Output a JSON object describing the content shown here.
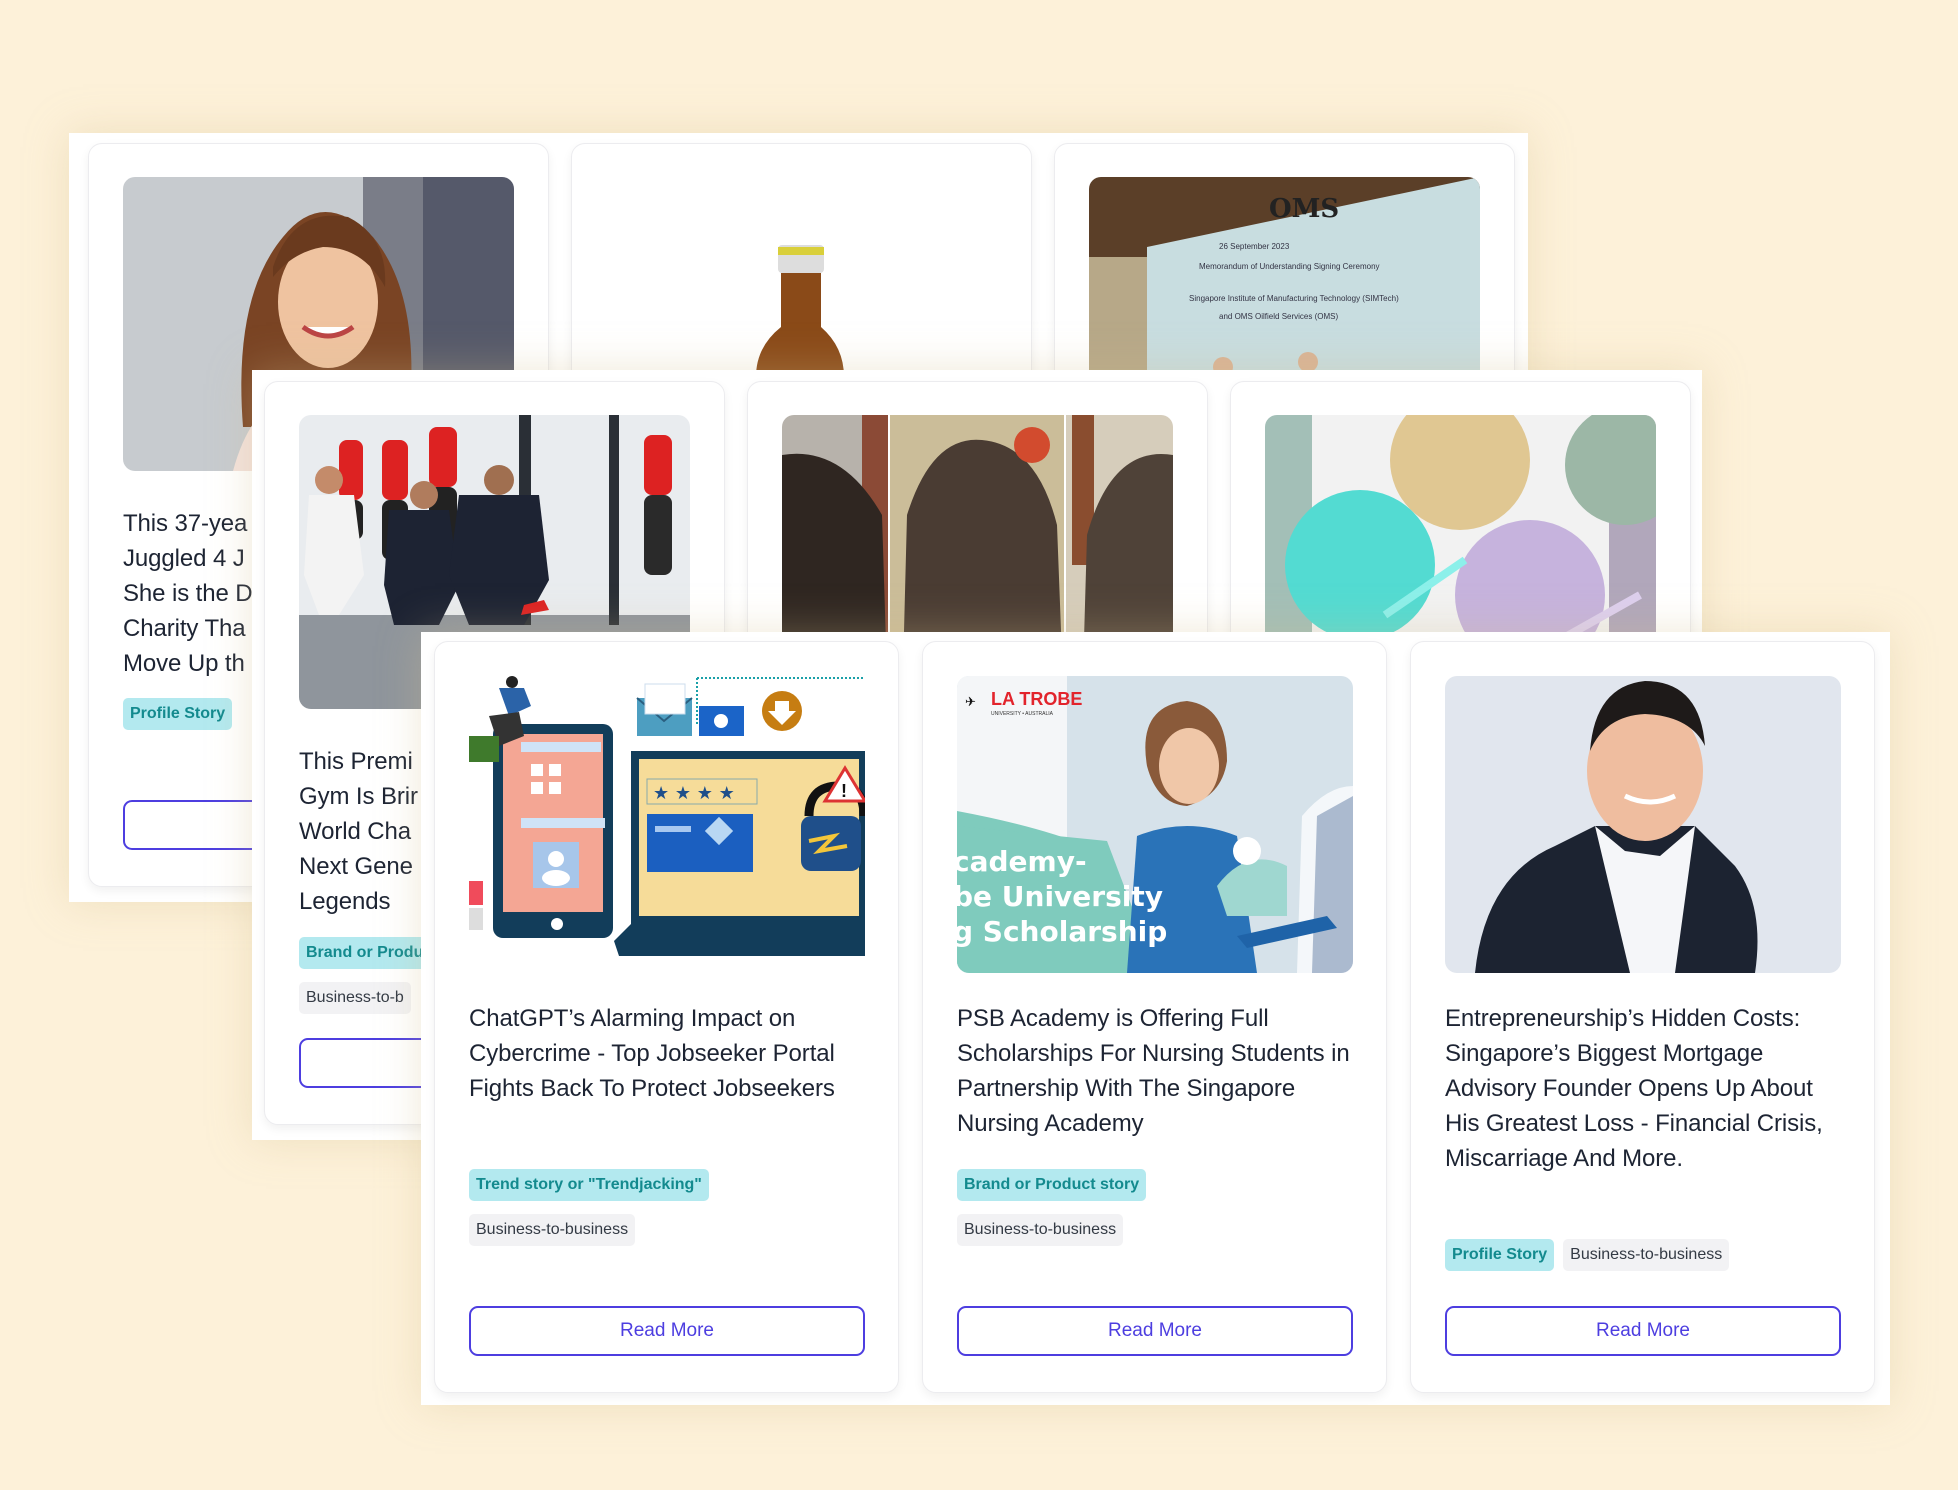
{
  "colors": {
    "background": "#FDF1D9",
    "accent": "#4D3EE0",
    "category_tag_bg": "#B3E9EF",
    "category_tag_text": "#138A8E",
    "audience_tag_bg": "#F2F2F4",
    "title_text": "#1D2433"
  },
  "back_panel": {
    "cards": [
      {
        "image": "smiling-woman-portrait",
        "title_lines": [
          "This 37-yea",
          "Juggled 4 J",
          "She is the D",
          "Charity Tha",
          "Move Up th"
        ],
        "tags": [
          "Profile Story"
        ],
        "button": ""
      },
      {
        "image": "amber-tonic-bottle"
      },
      {
        "image": "mou-signing-ceremony"
      }
    ]
  },
  "middle_panel": {
    "cards": [
      {
        "image": "kids-martial-arts-gym",
        "title_lines": [
          "This Premi",
          "Gym Is Brir",
          "World Cha",
          "Next Gene",
          "Legends"
        ],
        "category_tag": "Brand or Produ",
        "audience_tag": "Business-to-b",
        "button": ""
      },
      {
        "image": "hair-before-after"
      },
      {
        "image": "silicone-baby-plates"
      }
    ]
  },
  "front_panel": {
    "cards": [
      {
        "image": "cybercrime-illustration",
        "title": "ChatGPT’s Alarming Impact on Cybercrime - Top Jobseeker Portal Fights Back To Protect Jobseekers",
        "category_tag": "Trend story or \"Trendjacking\"",
        "audience_tag": "Business-to-business",
        "button": "Read More"
      },
      {
        "image": "la-trobe-nursing-scholarship",
        "image_text": {
          "logo": "LA TROBE",
          "logo_sub": "UNIVERSITY • AUSTRALIA",
          "line1": "cademy-",
          "line2": "be University",
          "line3": "g Scholarship"
        },
        "title": "PSB Academy is Offering Full Scholarships For Nursing Students in Partnership With The Singapore Nursing Academy",
        "category_tag": "Brand or Product story",
        "audience_tag": "Business-to-business",
        "button": "Read More"
      },
      {
        "image": "businessman-portrait",
        "title": "Entrepreneurship’s Hidden Costs: Singapore’s Biggest Mortgage Advisory Founder Opens Up About His Greatest Loss - Financial Crisis, Miscarriage And More.",
        "category_tag": "Profile Story",
        "audience_tag": "Business-to-business",
        "button": "Read More"
      }
    ]
  }
}
